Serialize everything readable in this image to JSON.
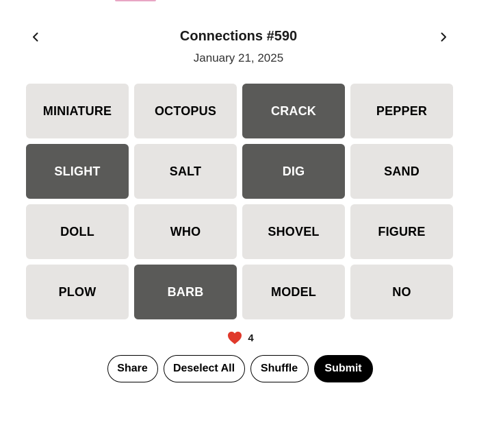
{
  "header": {
    "title": "Connections #590",
    "date": "January 21, 2025",
    "prev_icon": "chevron-left-icon",
    "next_icon": "chevron-right-icon"
  },
  "grid": {
    "tiles": [
      {
        "word": "MINIATURE",
        "selected": false
      },
      {
        "word": "OCTOPUS",
        "selected": false
      },
      {
        "word": "CRACK",
        "selected": true
      },
      {
        "word": "PEPPER",
        "selected": false
      },
      {
        "word": "SLIGHT",
        "selected": true
      },
      {
        "word": "SALT",
        "selected": false
      },
      {
        "word": "DIG",
        "selected": true
      },
      {
        "word": "SAND",
        "selected": false
      },
      {
        "word": "DOLL",
        "selected": false
      },
      {
        "word": "WHO",
        "selected": false
      },
      {
        "word": "SHOVEL",
        "selected": false
      },
      {
        "word": "FIGURE",
        "selected": false
      },
      {
        "word": "PLOW",
        "selected": false
      },
      {
        "word": "BARB",
        "selected": true
      },
      {
        "word": "MODEL",
        "selected": false
      },
      {
        "word": "NO",
        "selected": false
      }
    ]
  },
  "lives": {
    "icon": "heart-icon",
    "count": "4",
    "heart_color": "#e0392b"
  },
  "actions": {
    "share_label": "Share",
    "deselect_label": "Deselect All",
    "shuffle_label": "Shuffle",
    "submit_label": "Submit"
  },
  "colors": {
    "tile_default": "#e6e4e2",
    "tile_selected": "#5a5a58",
    "accent": "#e8a6c4"
  }
}
